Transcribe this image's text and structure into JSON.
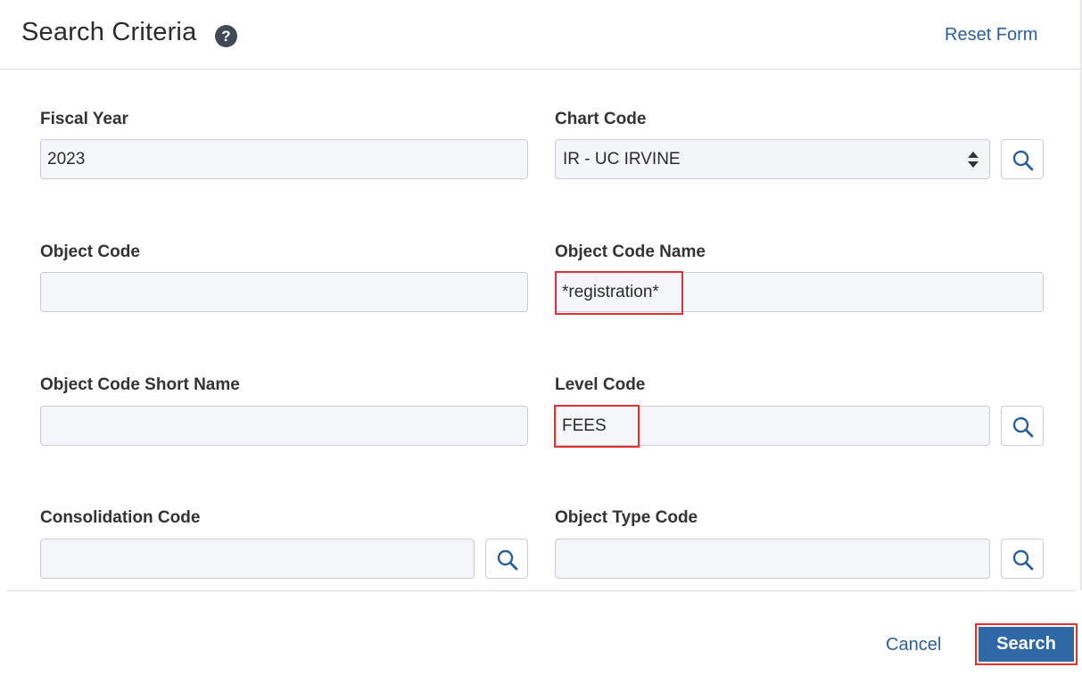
{
  "header": {
    "title": "Search Criteria",
    "help_icon_glyph": "?",
    "reset_label": "Reset Form"
  },
  "fields": {
    "fiscal_year": {
      "label": "Fiscal Year",
      "value": "2023"
    },
    "chart_code": {
      "label": "Chart Code",
      "value": "IR - UC IRVINE"
    },
    "object_code": {
      "label": "Object Code",
      "value": ""
    },
    "object_code_name": {
      "label": "Object Code Name",
      "value": "*registration*"
    },
    "object_code_short_name": {
      "label": "Object Code Short Name",
      "value": ""
    },
    "level_code": {
      "label": "Level Code",
      "value": "FEES"
    },
    "consolidation_code": {
      "label": "Consolidation Code",
      "value": ""
    },
    "object_type_code": {
      "label": "Object Type Code",
      "value": ""
    }
  },
  "footer": {
    "cancel_label": "Cancel",
    "search_label": "Search"
  },
  "colors": {
    "link": "#2c5f97",
    "primary_button": "#2f68a5",
    "highlight": "#e03131",
    "input_bg": "#f5f6fa"
  }
}
